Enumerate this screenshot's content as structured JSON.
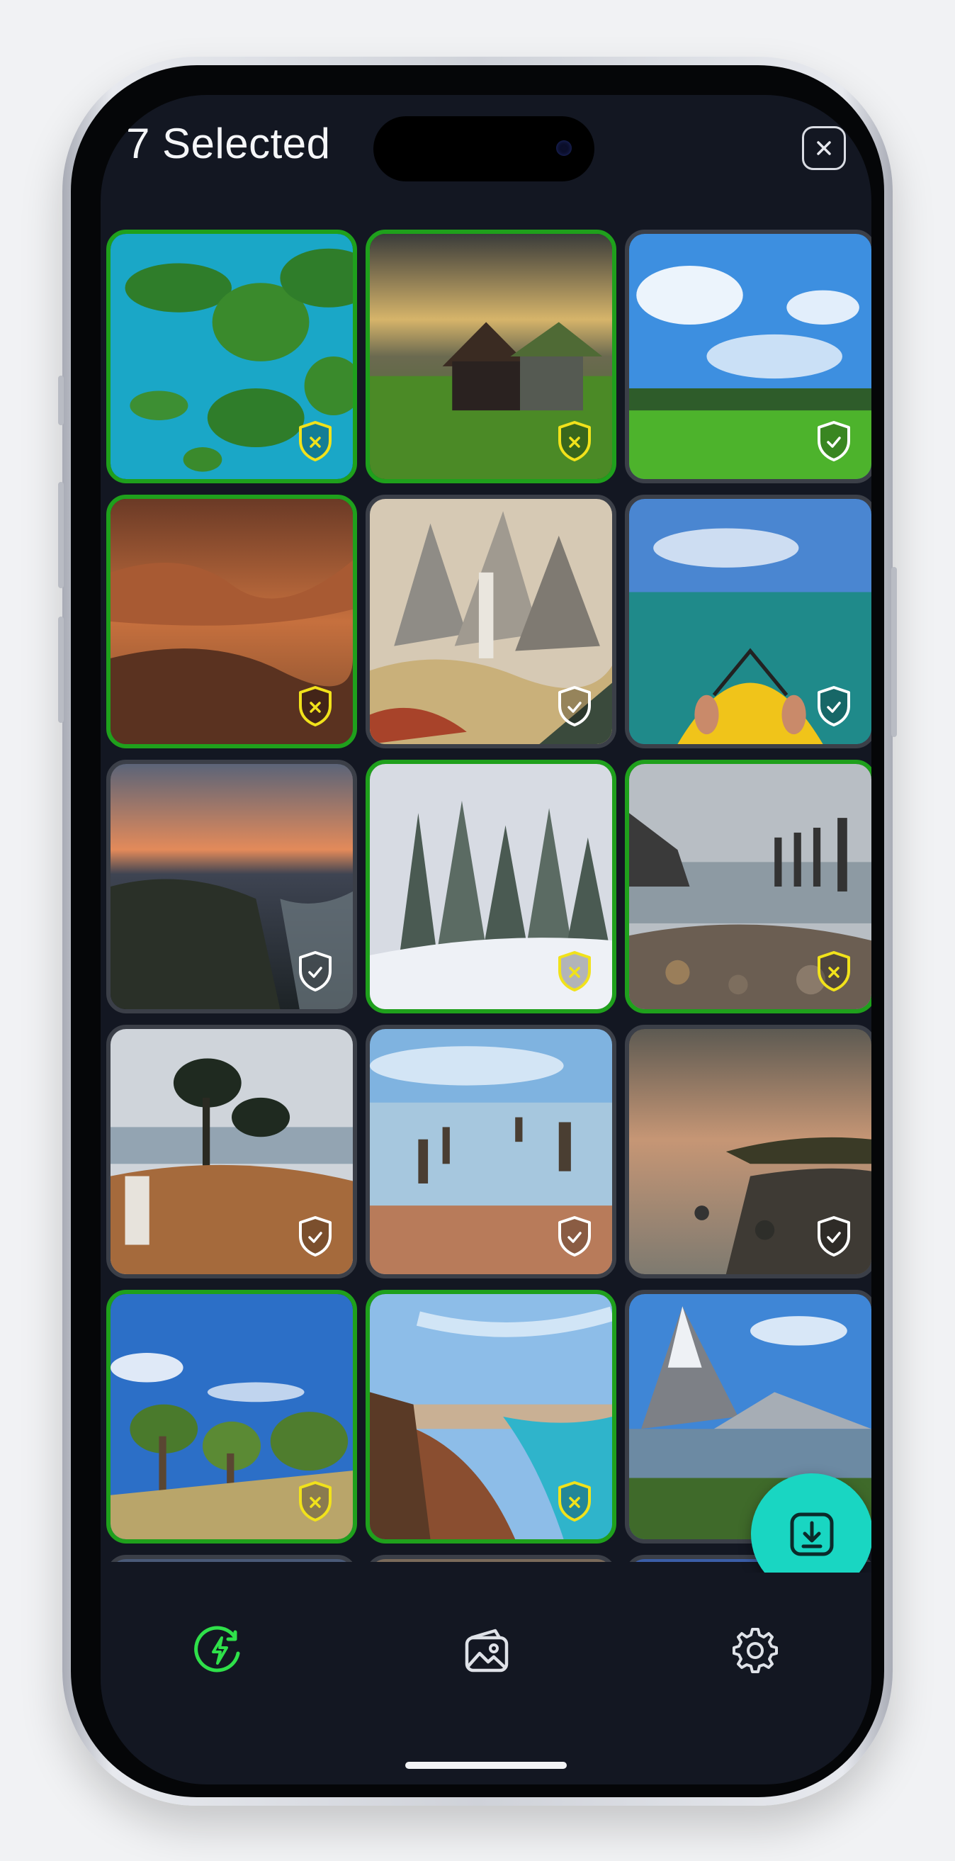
{
  "header": {
    "title": "7 Selected"
  },
  "colors": {
    "selected_border": "#1fa01c",
    "unselected_border": "#3b3f48",
    "selected_badge": "#f1e21b",
    "unselected_badge": "#ffffff",
    "fab": "#19d6c2",
    "nav_active": "#2fe04a",
    "background": "#131722"
  },
  "grid": {
    "tiles": [
      {
        "scene": "tropical-islands",
        "selected": true,
        "badge_icon": "shield-x-icon"
      },
      {
        "scene": "cottage-sunset",
        "selected": true,
        "badge_icon": "shield-x-icon"
      },
      {
        "scene": "green-field-sky",
        "selected": false,
        "badge_icon": "shield-check-icon"
      },
      {
        "scene": "grand-canyon",
        "selected": true,
        "badge_icon": "shield-x-icon"
      },
      {
        "scene": "painted-mountains",
        "selected": false,
        "badge_icon": "shield-check-icon"
      },
      {
        "scene": "kayak-sea",
        "selected": false,
        "badge_icon": "shield-check-icon"
      },
      {
        "scene": "cliff-dusk",
        "selected": false,
        "badge_icon": "shield-check-icon"
      },
      {
        "scene": "snowy-forest",
        "selected": true,
        "badge_icon": "shield-x-icon"
      },
      {
        "scene": "rocky-pier",
        "selected": true,
        "badge_icon": "shield-x-icon"
      },
      {
        "scene": "pine-shore",
        "selected": false,
        "badge_icon": "shield-check-icon"
      },
      {
        "scene": "blue-posts-sea",
        "selected": false,
        "badge_icon": "shield-check-icon"
      },
      {
        "scene": "dusk-beach",
        "selected": false,
        "badge_icon": "shield-check-icon"
      },
      {
        "scene": "savanna-trees",
        "selected": true,
        "badge_icon": "shield-x-icon"
      },
      {
        "scene": "coast-cliff",
        "selected": true,
        "badge_icon": "shield-x-icon"
      },
      {
        "scene": "matterhorn",
        "selected": false,
        "badge_icon": "shield-check-icon"
      }
    ]
  },
  "fab": {
    "icon": "download-icon"
  },
  "bottom_nav": {
    "items": [
      {
        "icon": "bolt-circle-icon",
        "active": true
      },
      {
        "icon": "wallet-image-icon",
        "active": false
      },
      {
        "icon": "gear-icon",
        "active": false
      }
    ]
  }
}
